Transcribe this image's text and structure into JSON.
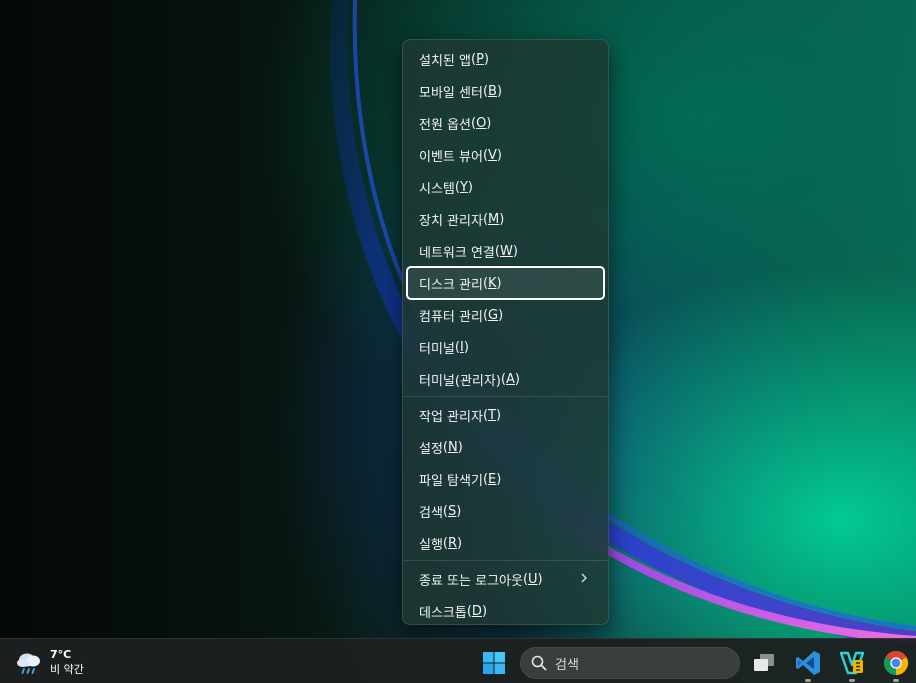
{
  "context_menu": {
    "items": [
      {
        "label": "설치된 앱",
        "mnemonic": "P"
      },
      {
        "label": "모바일 센터",
        "mnemonic": "B"
      },
      {
        "label": "전원 옵션",
        "mnemonic": "O"
      },
      {
        "label": "이벤트 뷰어",
        "mnemonic": "V"
      },
      {
        "label": "시스템",
        "mnemonic": "Y"
      },
      {
        "label": "장치 관리자",
        "mnemonic": "M"
      },
      {
        "label": "네트워크 연결",
        "mnemonic": "W"
      },
      {
        "label": "디스크 관리",
        "mnemonic": "K"
      },
      {
        "label": "컴퓨터 관리",
        "mnemonic": "G"
      },
      {
        "label": "터미널",
        "mnemonic": "I"
      },
      {
        "label": "터미널(관리자)",
        "mnemonic": "A"
      },
      {
        "label": "작업 관리자",
        "mnemonic": "T"
      },
      {
        "label": "설정",
        "mnemonic": "N"
      },
      {
        "label": "파일 탐색기",
        "mnemonic": "E"
      },
      {
        "label": "검색",
        "mnemonic": "S"
      },
      {
        "label": "실행",
        "mnemonic": "R"
      },
      {
        "label": "종료 또는 로그아웃",
        "mnemonic": "U"
      },
      {
        "label": "데스크톱",
        "mnemonic": "D"
      }
    ]
  },
  "taskbar": {
    "weather": {
      "temp": "7°C",
      "condition": "비 약간",
      "icon": "cloud-rain-icon"
    },
    "start_icon": "windows-start-icon",
    "search": {
      "label": "검색",
      "icon": "search-icon"
    },
    "apps": [
      {
        "name": "task-view-icon"
      },
      {
        "name": "vscode-icon"
      },
      {
        "name": "visual-studio-icon"
      },
      {
        "name": "chrome-icon"
      }
    ]
  },
  "colors": {
    "accent_start": "#3ab8f5",
    "vscode": "#2a8fdc",
    "focus_outline": "#ffffff"
  }
}
